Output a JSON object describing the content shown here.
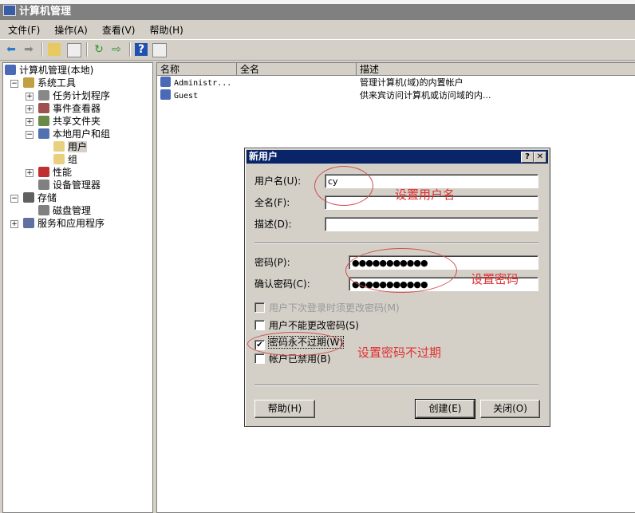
{
  "window": {
    "title": "计算机管理"
  },
  "menu": [
    "文件(F)",
    "操作(A)",
    "查看(V)",
    "帮助(H)"
  ],
  "tree": [
    {
      "label": "计算机管理(本地)",
      "level": 0,
      "exp": ""
    },
    {
      "label": "系统工具",
      "level": 1,
      "exp": "−"
    },
    {
      "label": "任务计划程序",
      "level": 2,
      "exp": "+"
    },
    {
      "label": "事件查看器",
      "level": 2,
      "exp": "+"
    },
    {
      "label": "共享文件夹",
      "level": 2,
      "exp": "+"
    },
    {
      "label": "本地用户和组",
      "level": 2,
      "exp": "−"
    },
    {
      "label": "用户",
      "level": 3,
      "exp": ""
    },
    {
      "label": "组",
      "level": 3,
      "exp": ""
    },
    {
      "label": "性能",
      "level": 2,
      "exp": "+"
    },
    {
      "label": "设备管理器",
      "level": 2,
      "exp": ""
    },
    {
      "label": "存储",
      "level": 1,
      "exp": "−"
    },
    {
      "label": "磁盘管理",
      "level": 2,
      "exp": ""
    },
    {
      "label": "服务和应用程序",
      "level": 1,
      "exp": "+"
    }
  ],
  "list": {
    "columns": [
      "名称",
      "全名",
      "描述"
    ],
    "rows": [
      {
        "name": "Administr...",
        "full": "",
        "desc": "管理计算机(域)的内置帐户"
      },
      {
        "name": "Guest",
        "full": "",
        "desc": "供来宾访问计算机或访问域的内..."
      }
    ]
  },
  "dialog": {
    "title": "新用户",
    "help_btn": "?",
    "close_btn": "✕",
    "username_label": "用户名(U):",
    "username": "cy",
    "fullname_label": "全名(F):",
    "fullname": "",
    "desc_label": "描述(D):",
    "desc": "",
    "password_label": "密码(P):",
    "password": "●●●●●●●●●●●",
    "confirm_label": "确认密码(C):",
    "confirm": "●●●●●●●●●●●",
    "checks": [
      {
        "label": "用户下次登录时须更改密码(M)",
        "checked": false,
        "disabled": true
      },
      {
        "label": "用户不能更改密码(S)",
        "checked": false,
        "disabled": false
      },
      {
        "label": "密码永不过期(W)",
        "checked": true,
        "disabled": false
      },
      {
        "label": "帐户已禁用(B)",
        "checked": false,
        "disabled": false
      }
    ],
    "help": "帮助(H)",
    "create": "创建(E)",
    "close": "关闭(O)"
  },
  "annotations": {
    "username": "设置用户名",
    "password": "设置密码",
    "never_expire": "设置密码不过期"
  }
}
